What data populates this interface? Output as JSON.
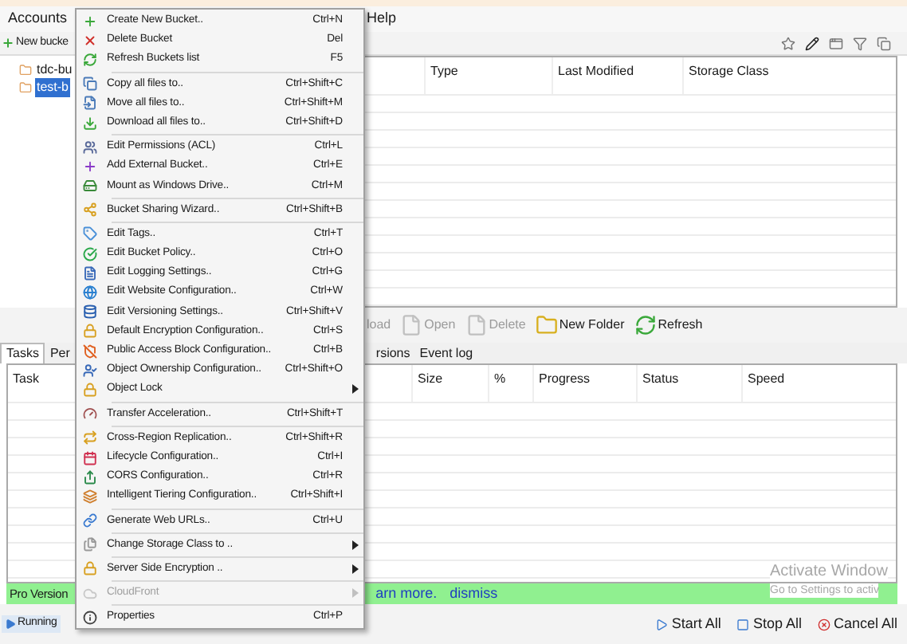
{
  "menu_bar": {
    "items": [
      {
        "label": "Accounts"
      },
      {
        "label": "Help"
      }
    ]
  },
  "toolbar": {
    "new_bucket": "New bucke"
  },
  "bucket_tree": [
    {
      "label": "tdc-bu",
      "selected": false
    },
    {
      "label": "test-b",
      "selected": true
    }
  ],
  "files_table": {
    "columns": [
      "Type",
      "Last Modified",
      "Storage Class"
    ]
  },
  "file_actions": [
    {
      "label": "load",
      "disabled": true
    },
    {
      "label": "Open",
      "disabled": true
    },
    {
      "label": "Delete",
      "disabled": true
    },
    {
      "label": "New Folder",
      "disabled": false
    },
    {
      "label": "Refresh",
      "disabled": false
    }
  ],
  "bottom_tabs": [
    {
      "label": "Tasks",
      "selected": true
    },
    {
      "label": "Per",
      "selected": false
    },
    {
      "label": "rsions",
      "selected": false
    },
    {
      "label": "Event log",
      "selected": false
    }
  ],
  "tasks_table": {
    "columns": [
      "Task",
      "Size",
      "%",
      "Progress",
      "Status",
      "Speed"
    ]
  },
  "pro_banner": {
    "label": "Pro Version",
    "link": "arn more.",
    "dismiss": "dismiss"
  },
  "status_bar": {
    "running": "Running",
    "buttons": [
      "Start All",
      "Stop All",
      "Cancel All"
    ]
  },
  "os_notice": {
    "title": "Activate Window",
    "subtitle": "Go to Settings to activ"
  },
  "context_menu": {
    "groups": [
      [
        {
          "label": "Create New Bucket..",
          "shortcut": "Ctrl+N",
          "submenu": false,
          "disabled": false
        },
        {
          "label": "Delete Bucket",
          "shortcut": "Del",
          "submenu": false,
          "disabled": false
        },
        {
          "label": "Refresh Buckets list",
          "shortcut": "F5",
          "submenu": false,
          "disabled": false
        }
      ],
      [
        {
          "label": "Copy all files to..",
          "shortcut": "Ctrl+Shift+C",
          "submenu": false,
          "disabled": false
        },
        {
          "label": "Move all files to..",
          "shortcut": "Ctrl+Shift+M",
          "submenu": false,
          "disabled": false
        },
        {
          "label": "Download all files to..",
          "shortcut": "Ctrl+Shift+D",
          "submenu": false,
          "disabled": false
        }
      ],
      [
        {
          "label": "Edit Permissions (ACL)",
          "shortcut": "Ctrl+L",
          "submenu": false,
          "disabled": false
        },
        {
          "label": "Add External Bucket..",
          "shortcut": "Ctrl+E",
          "submenu": false,
          "disabled": false
        },
        {
          "label": "Mount as Windows Drive..",
          "shortcut": "Ctrl+M",
          "submenu": false,
          "disabled": false
        }
      ],
      [
        {
          "label": "Bucket Sharing Wizard..",
          "shortcut": "Ctrl+Shift+B",
          "submenu": false,
          "disabled": false
        }
      ],
      [
        {
          "label": "Edit Tags..",
          "shortcut": "Ctrl+T",
          "submenu": false,
          "disabled": false
        },
        {
          "label": "Edit Bucket Policy..",
          "shortcut": "Ctrl+O",
          "submenu": false,
          "disabled": false
        },
        {
          "label": "Edit Logging Settings..",
          "shortcut": "Ctrl+G",
          "submenu": false,
          "disabled": false
        },
        {
          "label": "Edit Website Configuration..",
          "shortcut": "Ctrl+W",
          "submenu": false,
          "disabled": false
        },
        {
          "label": "Edit Versioning Settings..",
          "shortcut": "Ctrl+Shift+V",
          "submenu": false,
          "disabled": false
        },
        {
          "label": "Default Encryption Configuration..",
          "shortcut": "Ctrl+S",
          "submenu": false,
          "disabled": false
        },
        {
          "label": "Public Access Block Configuration..",
          "shortcut": "Ctrl+B",
          "submenu": false,
          "disabled": false
        },
        {
          "label": "Object Ownership Configuration..",
          "shortcut": "Ctrl+Shift+O",
          "submenu": false,
          "disabled": false
        },
        {
          "label": "Object Lock",
          "submenu": true,
          "disabled": false
        }
      ],
      [
        {
          "label": "Transfer Acceleration..",
          "shortcut": "Ctrl+Shift+T",
          "submenu": false,
          "disabled": false
        }
      ],
      [
        {
          "label": "Cross-Region Replication..",
          "shortcut": "Ctrl+Shift+R",
          "submenu": false,
          "disabled": false
        },
        {
          "label": "Lifecycle Configuration..",
          "shortcut": "Ctrl+I",
          "submenu": false,
          "disabled": false
        },
        {
          "label": "CORS Configuration..",
          "shortcut": "Ctrl+R",
          "submenu": false,
          "disabled": false
        },
        {
          "label": "Intelligent Tiering Configuration..",
          "shortcut": "Ctrl+Shift+I",
          "submenu": false,
          "disabled": false
        }
      ],
      [
        {
          "label": "Generate Web URLs..",
          "shortcut": "Ctrl+U",
          "submenu": false,
          "disabled": false
        }
      ],
      [
        {
          "label": "Change Storage Class to ..",
          "submenu": true,
          "disabled": false
        }
      ],
      [
        {
          "label": "Server Side Encryption ..",
          "submenu": true,
          "disabled": false
        }
      ],
      [
        {
          "label": "CloudFront",
          "submenu": true,
          "disabled": true
        }
      ],
      [
        {
          "label": "Properties",
          "shortcut": "Ctrl+P",
          "submenu": false,
          "disabled": false
        }
      ]
    ]
  }
}
